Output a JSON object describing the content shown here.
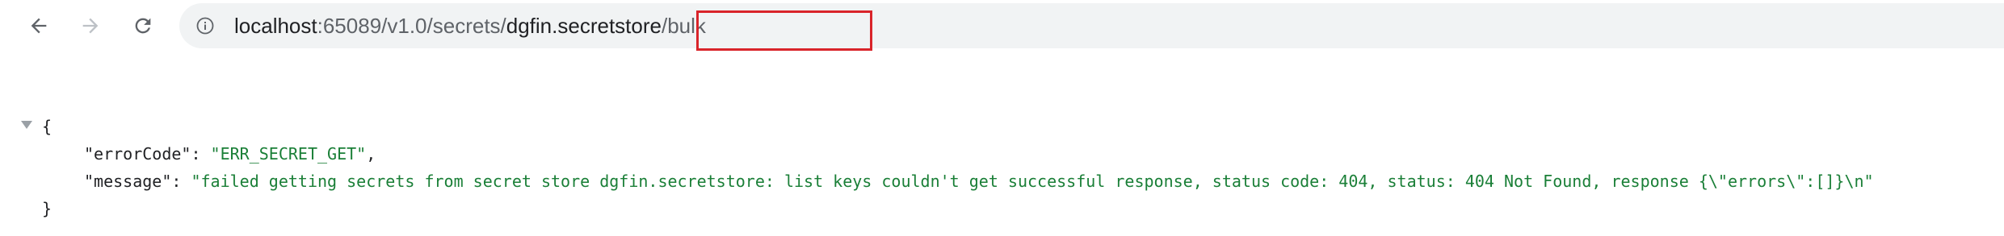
{
  "toolbar": {
    "back_icon": "arrow-left-icon",
    "forward_icon": "arrow-right-icon",
    "reload_icon": "reload-icon",
    "info_icon": "info-icon"
  },
  "address_bar": {
    "host": "localhost",
    "port_path": ":65089/v1.0/secrets/",
    "store_name": "dgfin.secretstore",
    "suffix": "/bulk"
  },
  "json": {
    "open_brace": "{",
    "close_brace": "}",
    "fields": [
      {
        "key": "\"errorCode\"",
        "sep": ": ",
        "value": "\"ERR_SECRET_GET\"",
        "trail": ","
      },
      {
        "key": "\"message\"",
        "sep": ": ",
        "value": "\"failed getting secrets from secret store dgfin.secretstore: list keys couldn't get successful response, status code: 404, status: 404 Not Found, response {\\\"errors\\\":[]}\\n\"",
        "trail": ""
      }
    ]
  },
  "colors": {
    "highlight": "#d9242a",
    "json_string": "#1a7f37",
    "omnibox_bg": "#f1f3f4"
  }
}
